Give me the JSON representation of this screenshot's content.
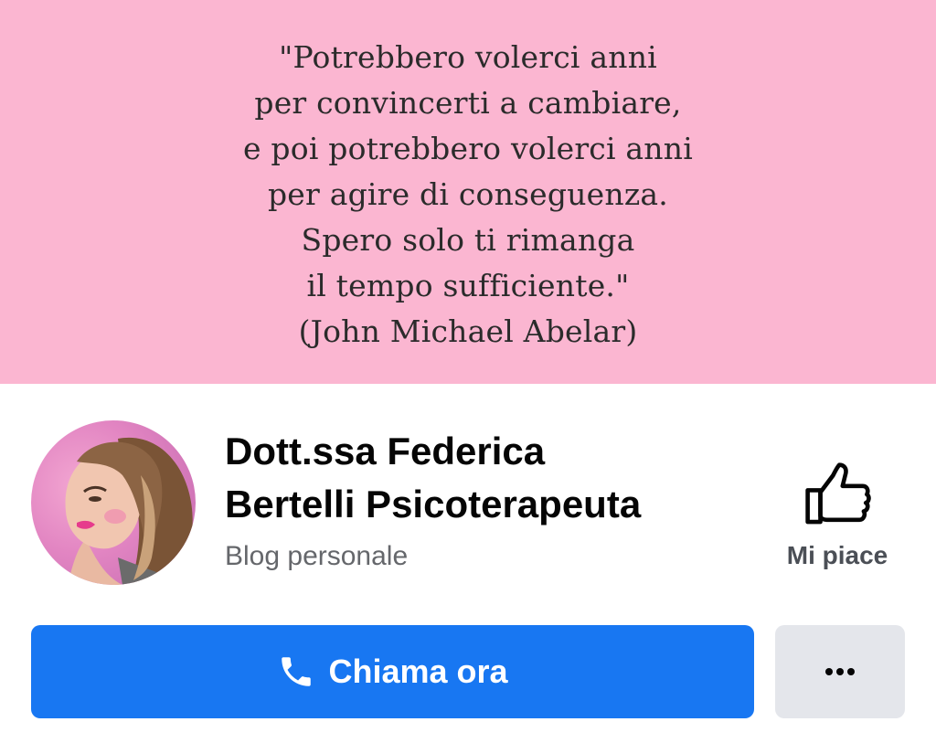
{
  "cover": {
    "quote_lines": [
      "\"Potrebbero volerci anni",
      "per convincerti a cambiare,",
      "e poi potrebbero volerci anni",
      "per agire di conseguenza.",
      "Spero solo ti rimanga",
      "il tempo sufficiente.\"",
      "(John Michael Abelar)"
    ],
    "background_color": "#fbb6d1"
  },
  "page": {
    "name_line1": "Dott.ssa Federica",
    "name_line2": "Bertelli Psicoterapeuta",
    "category": "Blog personale",
    "avatar_icon": "profile-photo"
  },
  "actions": {
    "like_label": "Mi piace",
    "like_icon": "thumbs-up-icon",
    "call_label": "Chiama ora",
    "call_icon": "phone-icon",
    "more_icon": "more-dots-icon",
    "primary_color": "#1877f2",
    "secondary_color": "#e4e6eb"
  }
}
